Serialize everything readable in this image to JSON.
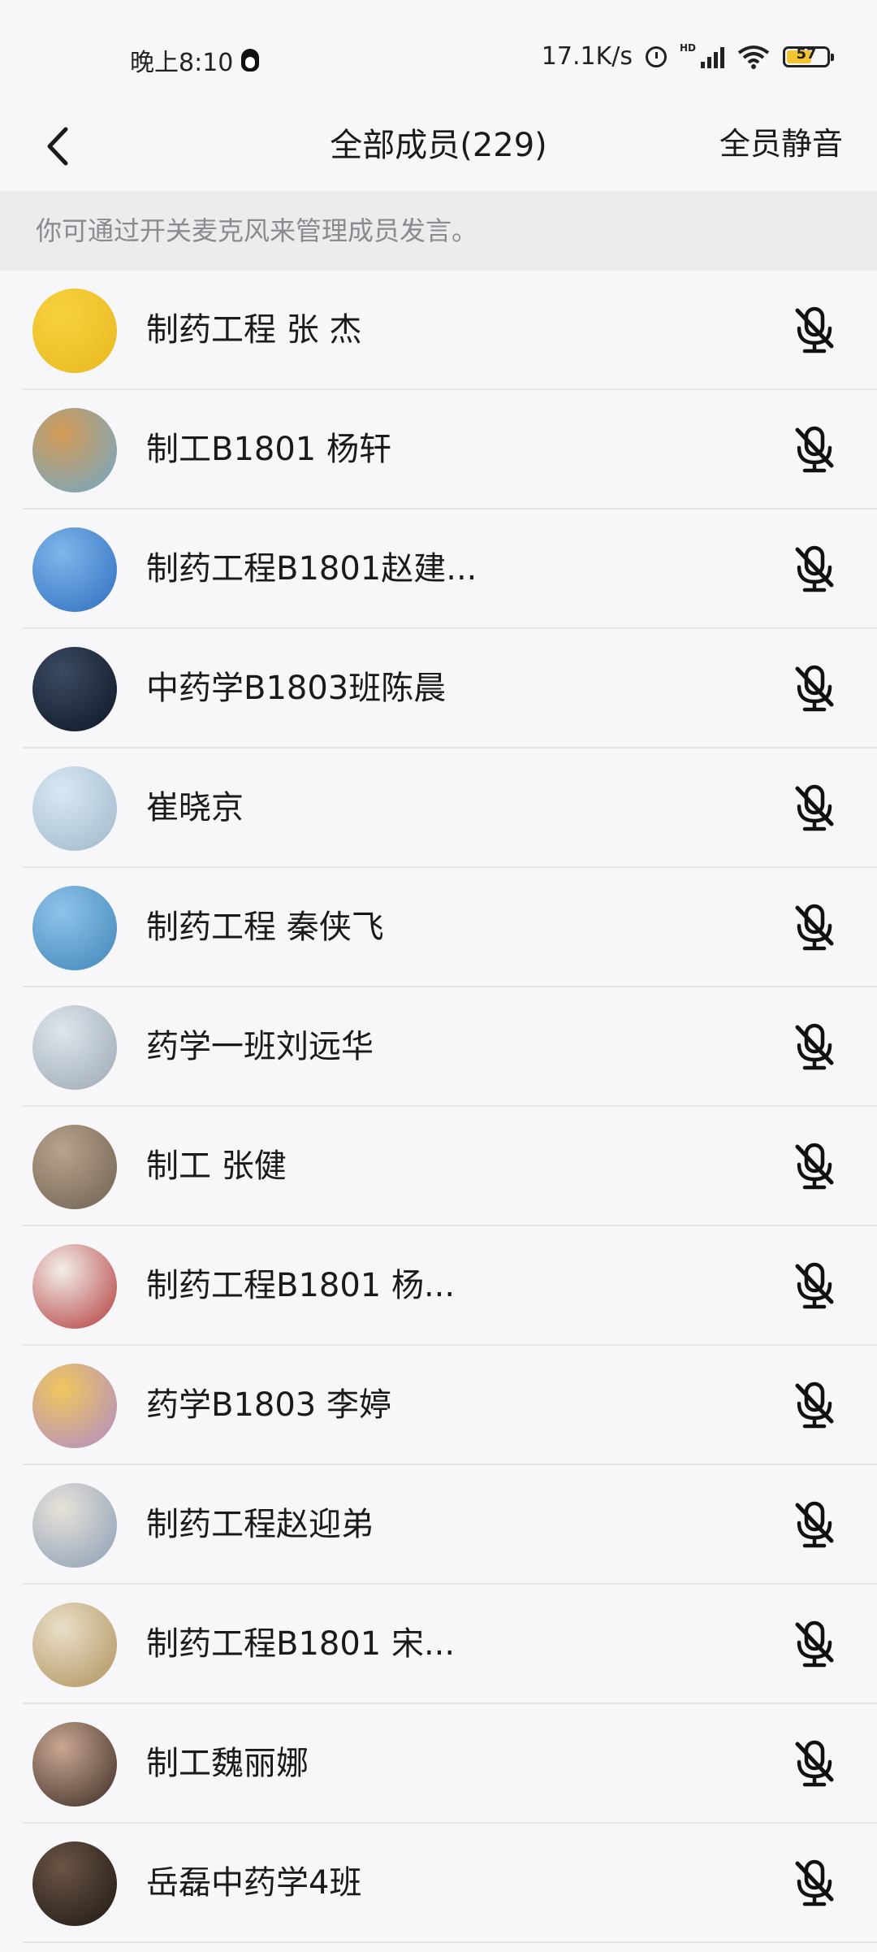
{
  "status_bar": {
    "time": "晚上8:10",
    "network_speed": "17.1K/s",
    "hd_label": "HD",
    "battery_level": "57"
  },
  "header": {
    "title": "全部成员(229)",
    "mute_all_label": "全员静音",
    "back_icon": "chevron-left-icon"
  },
  "hint": "你可通过开关麦克风来管理成员发言。",
  "members": [
    {
      "name": "制药工程 张 杰",
      "avatar_colors": [
        "#f7d23e",
        "#e8b820"
      ]
    },
    {
      "name": "制工B1801 杨轩",
      "avatar_colors": [
        "#d49a55",
        "#6fa9c9"
      ]
    },
    {
      "name": "制药工程B1801赵建...",
      "avatar_colors": [
        "#7fb6ea",
        "#2f6ec0"
      ]
    },
    {
      "name": "中药学B1803班陈晨",
      "avatar_colors": [
        "#3b4a63",
        "#0d1624"
      ]
    },
    {
      "name": "崔晓京",
      "avatar_colors": [
        "#d9e8f3",
        "#9fb7c9"
      ]
    },
    {
      "name": "制药工程  秦侠飞",
      "avatar_colors": [
        "#8fc3ea",
        "#3f86b8"
      ]
    },
    {
      "name": "药学一班刘远华",
      "avatar_colors": [
        "#dfe6ec",
        "#9aa7b3"
      ]
    },
    {
      "name": "制工 张健",
      "avatar_colors": [
        "#b9a48c",
        "#6e6052"
      ]
    },
    {
      "name": "制药工程B1801 杨...",
      "avatar_colors": [
        "#f3eee9",
        "#b23a3a"
      ]
    },
    {
      "name": "药学B1803 李婷",
      "avatar_colors": [
        "#f0c75e",
        "#b08ac9"
      ]
    },
    {
      "name": "制药工程赵迎弟",
      "avatar_colors": [
        "#e8e2da",
        "#8a9db5"
      ]
    },
    {
      "name": "制药工程B1801   宋...",
      "avatar_colors": [
        "#e9dfc9",
        "#b0925c"
      ]
    },
    {
      "name": "制工魏丽娜",
      "avatar_colors": [
        "#c9a792",
        "#3c2b24"
      ]
    },
    {
      "name": "岳磊中药学4班",
      "avatar_colors": [
        "#6a5445",
        "#1e1813"
      ]
    }
  ],
  "mic_icon": "microphone-muted-icon"
}
